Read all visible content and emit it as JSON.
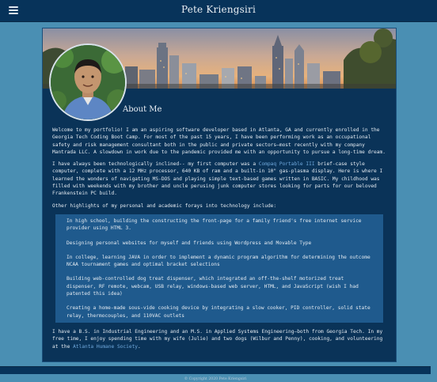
{
  "header": {
    "title": "Pete Kriengsiri",
    "menu_icon": "hamburger-menu-icon"
  },
  "about": {
    "heading": "About Me",
    "paragraphs": {
      "intro": "Welcome to my portfolio! I am an aspiring software developer based in Atlanta, GA and currently enrolled in the Georgia Tech Coding Boot Camp. For most of the past 15 years, I have been performing work as an occupational safety and risk management consultant both in the public and private sectors—most recently with my company Mantrada LLC. A slowdown in work due to the pandemic provided me with an opportunity to pursue a long-time dream.",
      "tech_before": "I have always been technologically inclined-- my first computer was a ",
      "tech_link": "Compaq Portable III",
      "tech_after": " brief-case style computer, complete with a 12 MHz processor, 640 KB of ram and a built-in 10\" gas-plasma display. Here is where I learned the wonders of navigating MS-DOS and playing simple text-based games written in BASIC. My childhood was filled with weekends with my brother and uncle perusing junk computer stores looking for parts for our beloved Frankenstein PC build.",
      "other": "Other highlights of my personal and academic forays into technology include:",
      "closing_before": "I have a B.S. in Industrial Engineering and an M.S. in Applied Systems Engineering—both from Georgia Tech. In my free time, I enjoy spending time with my wife (Julie) and two dogs (Wilbur and Penny), cooking, and volunteering at the ",
      "closing_link": "Atlanta Humane Society",
      "closing_after": "."
    },
    "highlights": [
      "In high school, building the constructing the front-page for a family friend's free internet service provider using HTML 3.",
      "Designing personal websites for myself and friends using Wordpress and Movable Type",
      "In college, learning JAVA in order to implement a dynamic program algorithm for determining the outcome NCAA tournament games and optimal bracket selections",
      "Building web-controlled dog treat dispenser, which integrated an off-the-shelf motorized treat dispenser, RF remote, webcam, USB relay, windows-based web server, HTML, and JavaScript (wish I had patented this idea)",
      "Creating a home-made sous-vide cooking device by integrating a slow cooker, PID controller, solid state relay, thermocouples, and 110VAC outlets"
    ]
  },
  "footer": {
    "copyright": "© Copyright 2020 Pete Kriengsiri"
  },
  "colors": {
    "page_bg": "#4a8fb3",
    "nav_bg": "#07335a",
    "card_bg": "#0a3358",
    "highlight_bg": "#1f5a8d",
    "link": "#6fa8dc"
  }
}
